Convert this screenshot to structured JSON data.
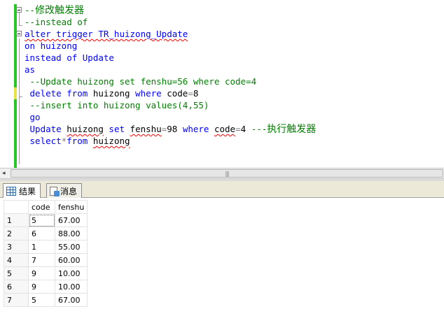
{
  "editor": {
    "lines": [
      {
        "parts": [
          {
            "t": "--",
            "c": "cm"
          },
          {
            "t": "修改触发器",
            "c": "cjk"
          }
        ]
      },
      {
        "parts": [
          {
            "t": "--instead of",
            "c": "cm"
          }
        ]
      },
      {
        "parts": [
          {
            "t": "alter trigger TR_huizong_Update",
            "c": "kw sq"
          }
        ]
      },
      {
        "parts": [
          {
            "t": "on huizong",
            "c": "kw"
          }
        ]
      },
      {
        "parts": [
          {
            "t": "instead of Update",
            "c": "kw"
          }
        ]
      },
      {
        "parts": [
          {
            "t": "as",
            "c": "kw"
          }
        ]
      },
      {
        "parts": [
          {
            "t": " --Update huizong set fenshu=56 where code=4",
            "c": "cm"
          }
        ]
      },
      {
        "parts": [
          {
            "t": " delete from ",
            "c": "kw"
          },
          {
            "t": "huizong",
            "c": ""
          },
          {
            "t": " where ",
            "c": "kw"
          },
          {
            "t": "code",
            "c": ""
          },
          {
            "t": "=",
            "c": "op"
          },
          {
            "t": "8",
            "c": ""
          }
        ]
      },
      {
        "parts": [
          {
            "t": " --insert into huizong values(4,55)",
            "c": "cm"
          }
        ]
      },
      {
        "parts": [
          {
            "t": " go",
            "c": "kw"
          }
        ]
      },
      {
        "parts": [
          {
            "t": " Update ",
            "c": "kw"
          },
          {
            "t": "huizong",
            "c": "sq"
          },
          {
            "t": " set ",
            "c": "kw"
          },
          {
            "t": "fenshu",
            "c": "sq"
          },
          {
            "t": "=",
            "c": "op"
          },
          {
            "t": "98",
            "c": ""
          },
          {
            "t": " where ",
            "c": "kw"
          },
          {
            "t": "code",
            "c": "sq"
          },
          {
            "t": "=",
            "c": "op"
          },
          {
            "t": "4 ",
            "c": ""
          },
          {
            "t": "---",
            "c": "cm"
          },
          {
            "t": "执行触发器",
            "c": "cjk"
          }
        ]
      },
      {
        "parts": [
          {
            "t": " select",
            "c": "kw"
          },
          {
            "t": "*",
            "c": "op"
          },
          {
            "t": "from ",
            "c": "kw"
          },
          {
            "t": "huizong",
            "c": "sq"
          }
        ]
      }
    ]
  },
  "scrollbar": {
    "left_arrow": "◂",
    "grip": "|||"
  },
  "tabs": [
    {
      "label": "结果",
      "icon": "grid-icon",
      "active": true
    },
    {
      "label": "消息",
      "icon": "messages-icon",
      "active": false
    }
  ],
  "results": {
    "columns": [
      "code",
      "fenshu"
    ],
    "rows": [
      {
        "n": "1",
        "code": "5",
        "fenshu": "67.00"
      },
      {
        "n": "2",
        "code": "6",
        "fenshu": "88.00"
      },
      {
        "n": "3",
        "code": "1",
        "fenshu": "55.00"
      },
      {
        "n": "4",
        "code": "7",
        "fenshu": "60.00"
      },
      {
        "n": "5",
        "code": "9",
        "fenshu": "10.00"
      },
      {
        "n": "6",
        "code": "9",
        "fenshu": "10.00"
      },
      {
        "n": "7",
        "code": "5",
        "fenshu": "67.00"
      }
    ]
  }
}
